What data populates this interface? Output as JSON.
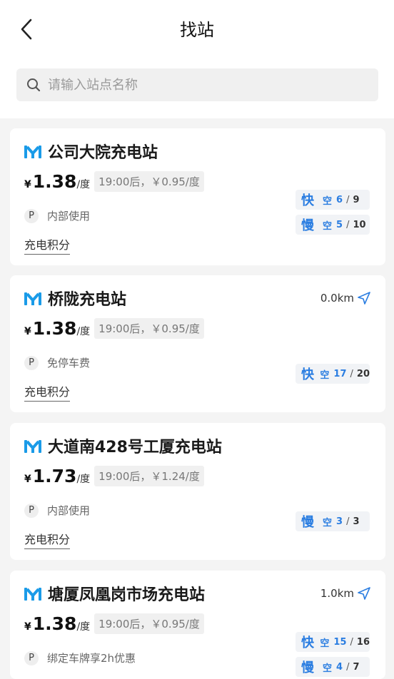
{
  "header": {
    "title": "找站"
  },
  "search": {
    "placeholder": "请输入站点名称"
  },
  "stations": [
    {
      "name": "公司大院充电站",
      "distance": "",
      "currency": "¥",
      "price": "1.38",
      "unit": "/度",
      "after_price": "19:00后，￥0.95/度",
      "parking": "内部使用",
      "points": "充电积分",
      "status": [
        {
          "kind": "快",
          "free_label": "空",
          "available": "6",
          "total": "9"
        },
        {
          "kind": "慢",
          "free_label": "空",
          "available": "5",
          "total": "10"
        }
      ]
    },
    {
      "name": "桥陇充电站",
      "distance": "0.0km",
      "currency": "¥",
      "price": "1.38",
      "unit": "/度",
      "after_price": "19:00后，￥0.95/度",
      "parking": "免停车费",
      "points": "充电积分",
      "status": [
        {
          "kind": "快",
          "free_label": "空",
          "available": "17",
          "total": "20"
        }
      ]
    },
    {
      "name": "大道南428号工厦充电站",
      "distance": "",
      "currency": "¥",
      "price": "1.73",
      "unit": "/度",
      "after_price": "19:00后，￥1.24/度",
      "parking": "内部使用",
      "points": "充电积分",
      "status": [
        {
          "kind": "慢",
          "free_label": "空",
          "available": "3",
          "total": "3"
        }
      ]
    },
    {
      "name": "塘厦凤凰岗市场充电站",
      "distance": "1.0km",
      "currency": "¥",
      "price": "1.38",
      "unit": "/度",
      "after_price": "19:00后，￥0.95/度",
      "parking": "绑定车牌享2h优惠",
      "points": "",
      "status": [
        {
          "kind": "快",
          "free_label": "空",
          "available": "15",
          "total": "16"
        },
        {
          "kind": "慢",
          "free_label": "空",
          "available": "4",
          "total": "7"
        }
      ]
    }
  ],
  "colors": {
    "accent": "#2a7de1",
    "logo_blue": "#1a9be8"
  },
  "icons": {
    "back": "chevron-left-icon",
    "search": "search-icon",
    "logo": "station-logo-icon",
    "navigate": "navigate-arrow-icon"
  }
}
